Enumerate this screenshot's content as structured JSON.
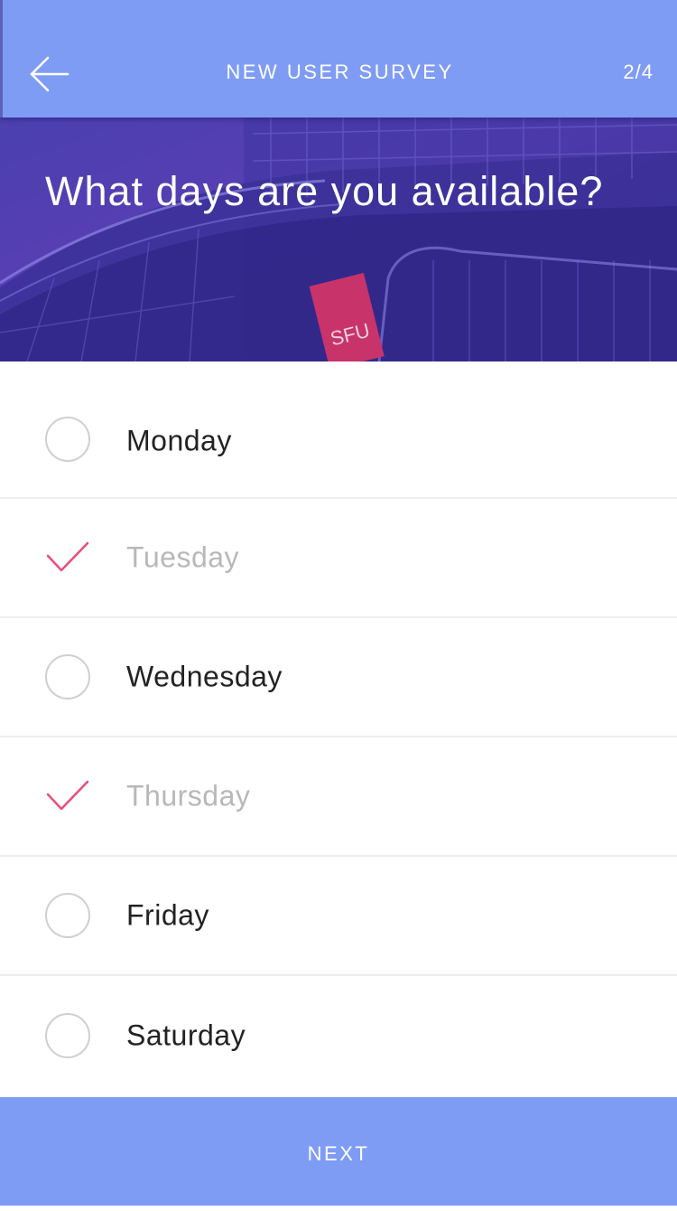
{
  "nav": {
    "back_icon": "arrow-left-icon",
    "title": "NEW USER SURVEY",
    "step": "2/4"
  },
  "hero": {
    "question": "What days are you available?",
    "sign_text": "SFU"
  },
  "days": [
    {
      "label": "Monday",
      "checked": false
    },
    {
      "label": "Tuesday",
      "checked": true
    },
    {
      "label": "Wednesday",
      "checked": false
    },
    {
      "label": "Thursday",
      "checked": true
    },
    {
      "label": "Friday",
      "checked": false
    },
    {
      "label": "Saturday",
      "checked": false
    }
  ],
  "footer": {
    "next_label": "NEXT"
  },
  "colors": {
    "primary": "#7f9cf5",
    "hero_overlay": "#4b3fb0",
    "check": "#ec4c7a",
    "sign": "#c8336a"
  }
}
